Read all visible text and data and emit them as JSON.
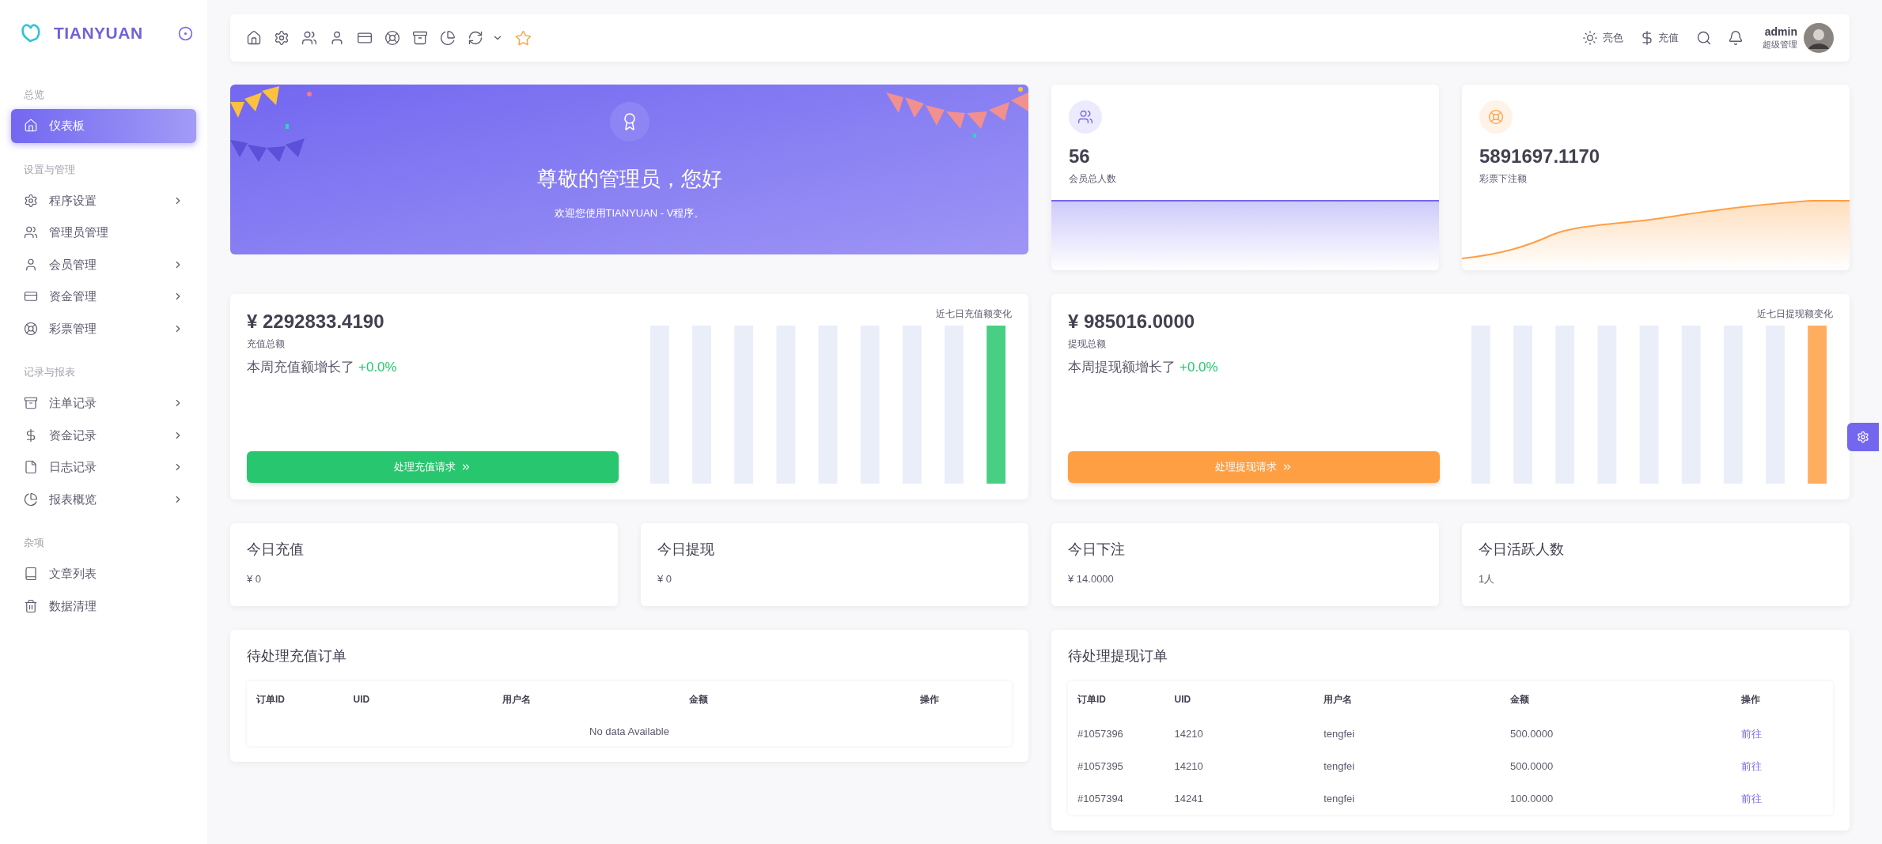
{
  "brand": {
    "name": "TIANYUAN"
  },
  "sidebar": {
    "sections": [
      {
        "title": "总览",
        "items": [
          {
            "label": "仪表板",
            "selected": true,
            "has_submenu": false
          }
        ]
      },
      {
        "title": "设置与管理",
        "items": [
          {
            "label": "程序设置",
            "selected": false,
            "has_submenu": true
          },
          {
            "label": "管理员管理",
            "selected": false,
            "has_submenu": false
          },
          {
            "label": "会员管理",
            "selected": false,
            "has_submenu": true
          },
          {
            "label": "资金管理",
            "selected": false,
            "has_submenu": true
          },
          {
            "label": "彩票管理",
            "selected": false,
            "has_submenu": true
          }
        ]
      },
      {
        "title": "记录与报表",
        "items": [
          {
            "label": "注单记录",
            "selected": false,
            "has_submenu": true
          },
          {
            "label": "资金记录",
            "selected": false,
            "has_submenu": true
          },
          {
            "label": "日志记录",
            "selected": false,
            "has_submenu": true
          },
          {
            "label": "报表概览",
            "selected": false,
            "has_submenu": true
          }
        ]
      },
      {
        "title": "杂项",
        "items": [
          {
            "label": "文章列表",
            "selected": false,
            "has_submenu": false
          },
          {
            "label": "数据清理",
            "selected": false,
            "has_submenu": false
          }
        ]
      }
    ]
  },
  "topbar": {
    "theme_label": "亮色",
    "recharge_label": "充值",
    "user": {
      "name": "admin",
      "role": "超级管理"
    }
  },
  "welcome": {
    "title": "尊敬的管理员，您好",
    "subtitle": "欢迎您使用TIANYUAN - V程序。"
  },
  "stat_cards": [
    {
      "value": "56",
      "label": "会员总人数",
      "color": "#7367f0",
      "kind": "flat"
    },
    {
      "value": "5891697.1170",
      "label": "彩票下注额",
      "color": "#ff9f43",
      "kind": "rising"
    }
  ],
  "summary_cards": [
    {
      "amount": "¥ 2292833.4190",
      "label": "充值总额",
      "growth_text": "本周充值额增长了",
      "growth_value": "+0.0%",
      "button": "处理充值请求",
      "chart_caption": "近七日充值额变化",
      "color": "#28c76f"
    },
    {
      "amount": "¥ 985016.0000",
      "label": "提现总额",
      "growth_text": "本周提现额增长了",
      "growth_value": "+0.0%",
      "button": "处理提现请求",
      "chart_caption": "近七日提现额变化",
      "color": "#ff9f43"
    }
  ],
  "today_cards": [
    {
      "title": "今日充值",
      "value": "¥ 0"
    },
    {
      "title": "今日提现",
      "value": "¥ 0"
    },
    {
      "title": "今日下注",
      "value": "¥ 14.0000"
    },
    {
      "title": "今日活跃人数",
      "value": "1人"
    }
  ],
  "tables": [
    {
      "title": "待处理充值订单",
      "columns": [
        "订单ID",
        "UID",
        "用户名",
        "金额",
        "操作"
      ],
      "empty_text": "No data Available"
    },
    {
      "title": "待处理提现订单",
      "columns": [
        "订单ID",
        "UID",
        "用户名",
        "金额",
        "操作"
      ],
      "rows": [
        {
          "cells": [
            "#1057396",
            "14210",
            "tengfei",
            "500.0000",
            "前往"
          ]
        },
        {
          "cells": [
            "#1057395",
            "14210",
            "tengfei",
            "500.0000",
            "前往"
          ]
        },
        {
          "cells": [
            "#1057394",
            "14241",
            "tengfei",
            "100.0000",
            "前往"
          ]
        }
      ]
    }
  ]
}
